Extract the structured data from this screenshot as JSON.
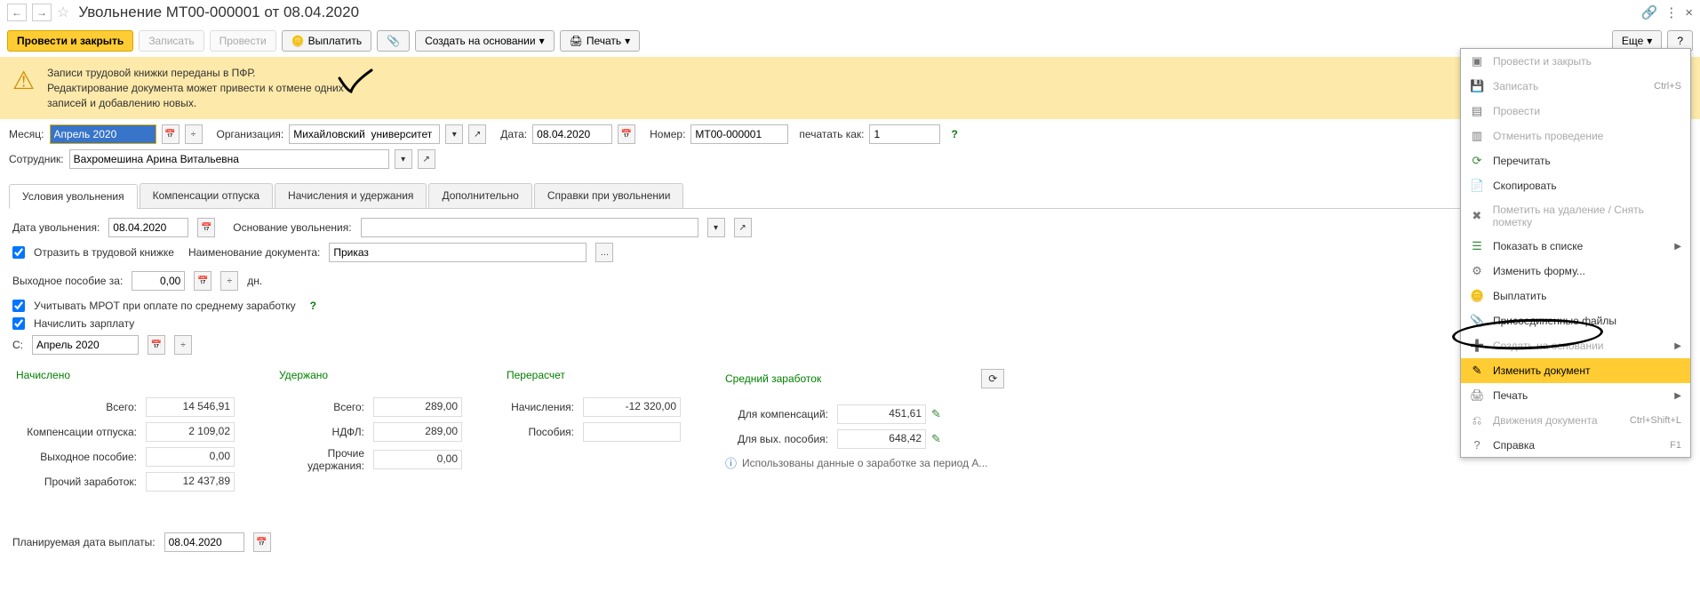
{
  "title": "Увольнение МТ00-000001 от 08.04.2020",
  "toolbar": {
    "post_close": "Провести и закрыть",
    "save": "Записать",
    "post": "Провести",
    "pay": "Выплатить",
    "create_based": "Создать на основании",
    "print": "Печать",
    "more": "Еще",
    "help": "?"
  },
  "banner": {
    "line1": "Записи трудовой книжки переданы в ПФР.",
    "line2": "Редактирование документа может привести к отмене одних",
    "line3": "записей и добавлению новых."
  },
  "header": {
    "month_label": "Месяц:",
    "month_value": "Апрель 2020",
    "org_label": "Организация:",
    "org_value": "Михайловский  университет",
    "date_label": "Дата:",
    "date_value": "08.04.2020",
    "number_label": "Номер:",
    "number_value": "МТ00-000001",
    "printas_label": "печатать как:",
    "printas_value": "1",
    "employee_label": "Сотрудник:",
    "employee_value": "Вахромешина Арина Витальевна"
  },
  "tabs": [
    "Условия увольнения",
    "Компенсации отпуска",
    "Начисления и удержания",
    "Дополнительно",
    "Справки при увольнении"
  ],
  "tab_active": 0,
  "tab1": {
    "dismiss_date_label": "Дата увольнения:",
    "dismiss_date": "08.04.2020",
    "basis_label": "Основание увольнения:",
    "basis": "",
    "reflect_label": "Отразить в трудовой книжке",
    "docname_label": "Наименование документа:",
    "docname_value": "Приказ",
    "severance_label": "Выходное пособие за:",
    "severance_value": "0,00",
    "severance_unit": "дн.",
    "mrot_label": "Учитывать МРОТ при оплате по среднему заработку",
    "accrue_label": "Начислить зарплату",
    "from_label": "С:",
    "from_value": "Апрель 2020"
  },
  "summary": {
    "accrued_head": "Начислено",
    "deducted_head": "Удержано",
    "recalc_head": "Перерасчет",
    "avg_head": "Средний заработок",
    "total_label": "Всего:",
    "total_accrued": "14 546,91",
    "comp_label": "Компенсации отпуска:",
    "comp_val": "2 109,02",
    "sev_label": "Выходное пособие:",
    "sev_val": "0,00",
    "other_label": "Прочий заработок:",
    "other_val": "12 437,89",
    "total_ded": "289,00",
    "ndfl_label": "НДФЛ:",
    "ndfl_val": "289,00",
    "otherded_label": "Прочие удержания:",
    "otherded_val": "0,00",
    "accr_recalc_label": "Начисления:",
    "accr_recalc_val": "-12 320,00",
    "benefit_label": "Пособия:",
    "benefit_val": "",
    "forcomp_label": "Для компенсаций:",
    "forcomp_val": "451,61",
    "forsev_label": "Для вых. пособия:",
    "forsev_val": "648,42",
    "avg_info": "Использованы данные о заработке за период А...",
    "planned_label": "Планируемая дата выплаты:",
    "planned_val": "08.04.2020"
  },
  "menu": {
    "post_close": "Провести и закрыть",
    "save": "Записать",
    "save_sc": "Ctrl+S",
    "post": "Провести",
    "cancel_post": "Отменить проведение",
    "reread": "Перечитать",
    "copy": "Скопировать",
    "mark_delete": "Пометить на удаление / Снять пометку",
    "show_in_list": "Показать в списке",
    "change_form": "Изменить форму...",
    "pay": "Выплатить",
    "attached": "Присоединенные файлы",
    "create_based": "Создать на основании",
    "edit_doc": "Изменить документ",
    "print": "Печать",
    "movements": "Движения документа",
    "movements_sc": "Ctrl+Shift+L",
    "help": "Справка",
    "help_sc": "F1"
  }
}
